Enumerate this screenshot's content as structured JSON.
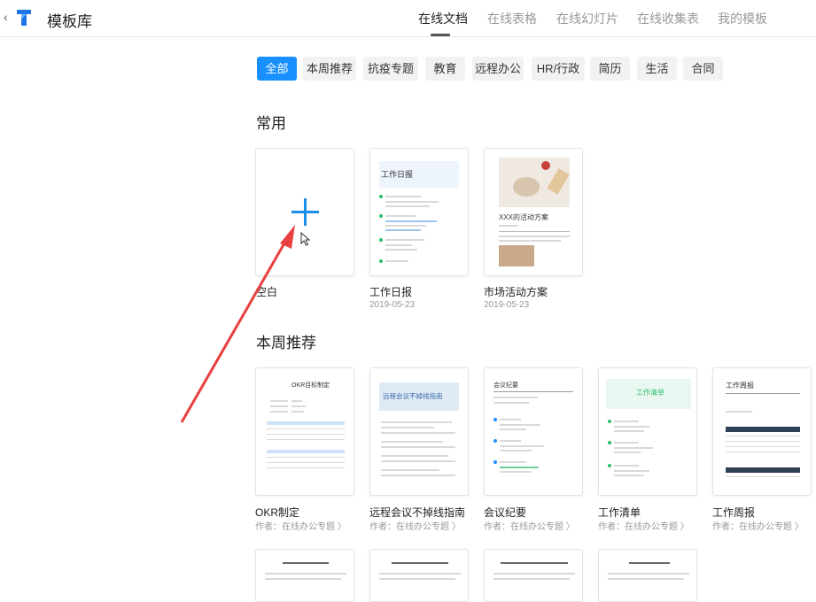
{
  "header": {
    "back_glyph": "‹",
    "logo_icon": "template-library-logo-icon",
    "title": "模板库",
    "tabs": [
      {
        "label": "在线文档",
        "active": true
      },
      {
        "label": "在线表格",
        "active": false
      },
      {
        "label": "在线幻灯片",
        "active": false
      },
      {
        "label": "在线收集表",
        "active": false
      },
      {
        "label": "我的模板",
        "active": false
      }
    ]
  },
  "filters": [
    {
      "label": "全部",
      "active": true
    },
    {
      "label": "本周推荐"
    },
    {
      "label": "抗疫专题"
    },
    {
      "label": "教育"
    },
    {
      "label": "远程办公"
    },
    {
      "label": "HR/行政"
    },
    {
      "label": "简历"
    },
    {
      "label": "生活"
    },
    {
      "label": "合同"
    }
  ],
  "sections": {
    "common": {
      "title": "常用",
      "cards": [
        {
          "name": "空白",
          "date": ""
        },
        {
          "name": "工作日报",
          "date": "2019-05-23",
          "thumb_title": "工作日报"
        },
        {
          "name": "市场活动方案",
          "date": "2019-05-23",
          "thumb_title": "XXX的活动方案"
        }
      ]
    },
    "weekly": {
      "title": "本周推荐",
      "cards": [
        {
          "name": "OKR制定",
          "author": "作者：在线办公专题 〉",
          "thumb_title": "OKR目标制定"
        },
        {
          "name": "远程会议不掉线指南",
          "author": "作者：在线办公专题 〉",
          "thumb_title": "远程会议不掉线指南"
        },
        {
          "name": "会议纪要",
          "author": "作者：在线办公专题 〉",
          "thumb_title": "会议纪要"
        },
        {
          "name": "工作清单",
          "author": "作者：在线办公专题 〉",
          "thumb_title": "工作清单"
        },
        {
          "name": "工作周报",
          "author": "作者：在线办公专题 〉",
          "thumb_title": "工作周报"
        }
      ]
    }
  },
  "colors": {
    "accent": "#1890ff",
    "plus": "#1a8fe8",
    "annotation_arrow": "#e84040"
  }
}
